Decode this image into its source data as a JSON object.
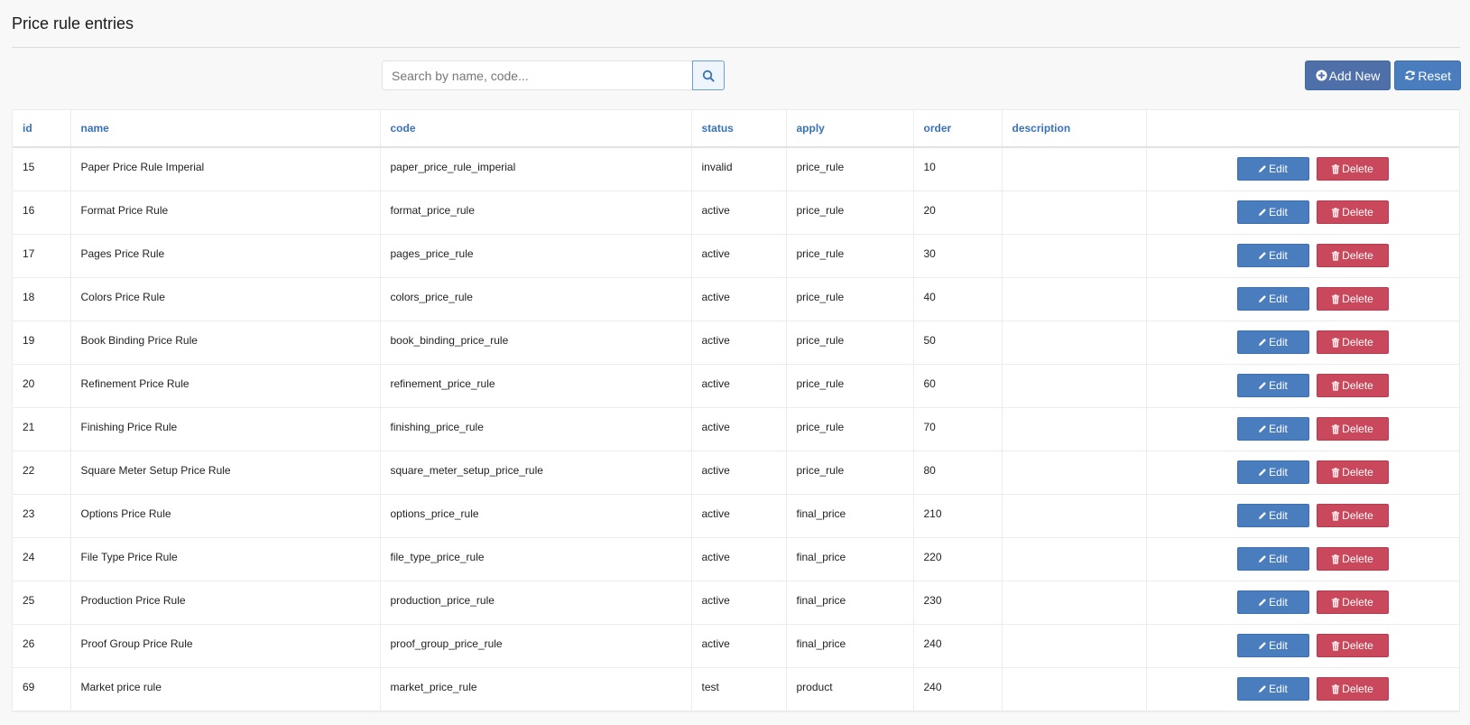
{
  "page": {
    "title": "Price rule entries"
  },
  "search": {
    "placeholder": "Search by name, code...",
    "value": ""
  },
  "toolbar": {
    "add_label": "Add New",
    "reset_label": "Reset"
  },
  "table": {
    "columns": [
      "id",
      "name",
      "code",
      "status",
      "apply",
      "order",
      "description",
      ""
    ],
    "edit_label": "Edit",
    "delete_label": "Delete",
    "rows": [
      {
        "id": "15",
        "name": "Paper Price Rule Imperial",
        "code": "paper_price_rule_imperial",
        "status": "invalid",
        "apply": "price_rule",
        "order": "10",
        "description": ""
      },
      {
        "id": "16",
        "name": "Format Price Rule",
        "code": "format_price_rule",
        "status": "active",
        "apply": "price_rule",
        "order": "20",
        "description": ""
      },
      {
        "id": "17",
        "name": "Pages Price Rule",
        "code": "pages_price_rule",
        "status": "active",
        "apply": "price_rule",
        "order": "30",
        "description": ""
      },
      {
        "id": "18",
        "name": "Colors Price Rule",
        "code": "colors_price_rule",
        "status": "active",
        "apply": "price_rule",
        "order": "40",
        "description": ""
      },
      {
        "id": "19",
        "name": "Book Binding Price Rule",
        "code": "book_binding_price_rule",
        "status": "active",
        "apply": "price_rule",
        "order": "50",
        "description": ""
      },
      {
        "id": "20",
        "name": "Refinement Price Rule",
        "code": "refinement_price_rule",
        "status": "active",
        "apply": "price_rule",
        "order": "60",
        "description": ""
      },
      {
        "id": "21",
        "name": "Finishing Price Rule",
        "code": "finishing_price_rule",
        "status": "active",
        "apply": "price_rule",
        "order": "70",
        "description": ""
      },
      {
        "id": "22",
        "name": "Square Meter Setup Price Rule",
        "code": "square_meter_setup_price_rule",
        "status": "active",
        "apply": "price_rule",
        "order": "80",
        "description": ""
      },
      {
        "id": "23",
        "name": "Options Price Rule",
        "code": "options_price_rule",
        "status": "active",
        "apply": "final_price",
        "order": "210",
        "description": ""
      },
      {
        "id": "24",
        "name": "File Type Price Rule",
        "code": "file_type_price_rule",
        "status": "active",
        "apply": "final_price",
        "order": "220",
        "description": ""
      },
      {
        "id": "25",
        "name": "Production Price Rule",
        "code": "production_price_rule",
        "status": "active",
        "apply": "final_price",
        "order": "230",
        "description": ""
      },
      {
        "id": "26",
        "name": "Proof Group Price Rule",
        "code": "proof_group_price_rule",
        "status": "active",
        "apply": "final_price",
        "order": "240",
        "description": ""
      },
      {
        "id": "69",
        "name": "Market price rule",
        "code": "market_price_rule",
        "status": "test",
        "apply": "product",
        "order": "240",
        "description": ""
      }
    ]
  },
  "icons": {
    "search": "search-icon",
    "add": "plus-circle-icon",
    "reset": "refresh-icon",
    "edit": "pencil-icon",
    "delete": "trash-icon"
  },
  "colors": {
    "header_text": "#3a72b6",
    "add_button": "#4f6fa8",
    "primary_button": "#4a7dbd",
    "danger_button": "#c9485b"
  }
}
